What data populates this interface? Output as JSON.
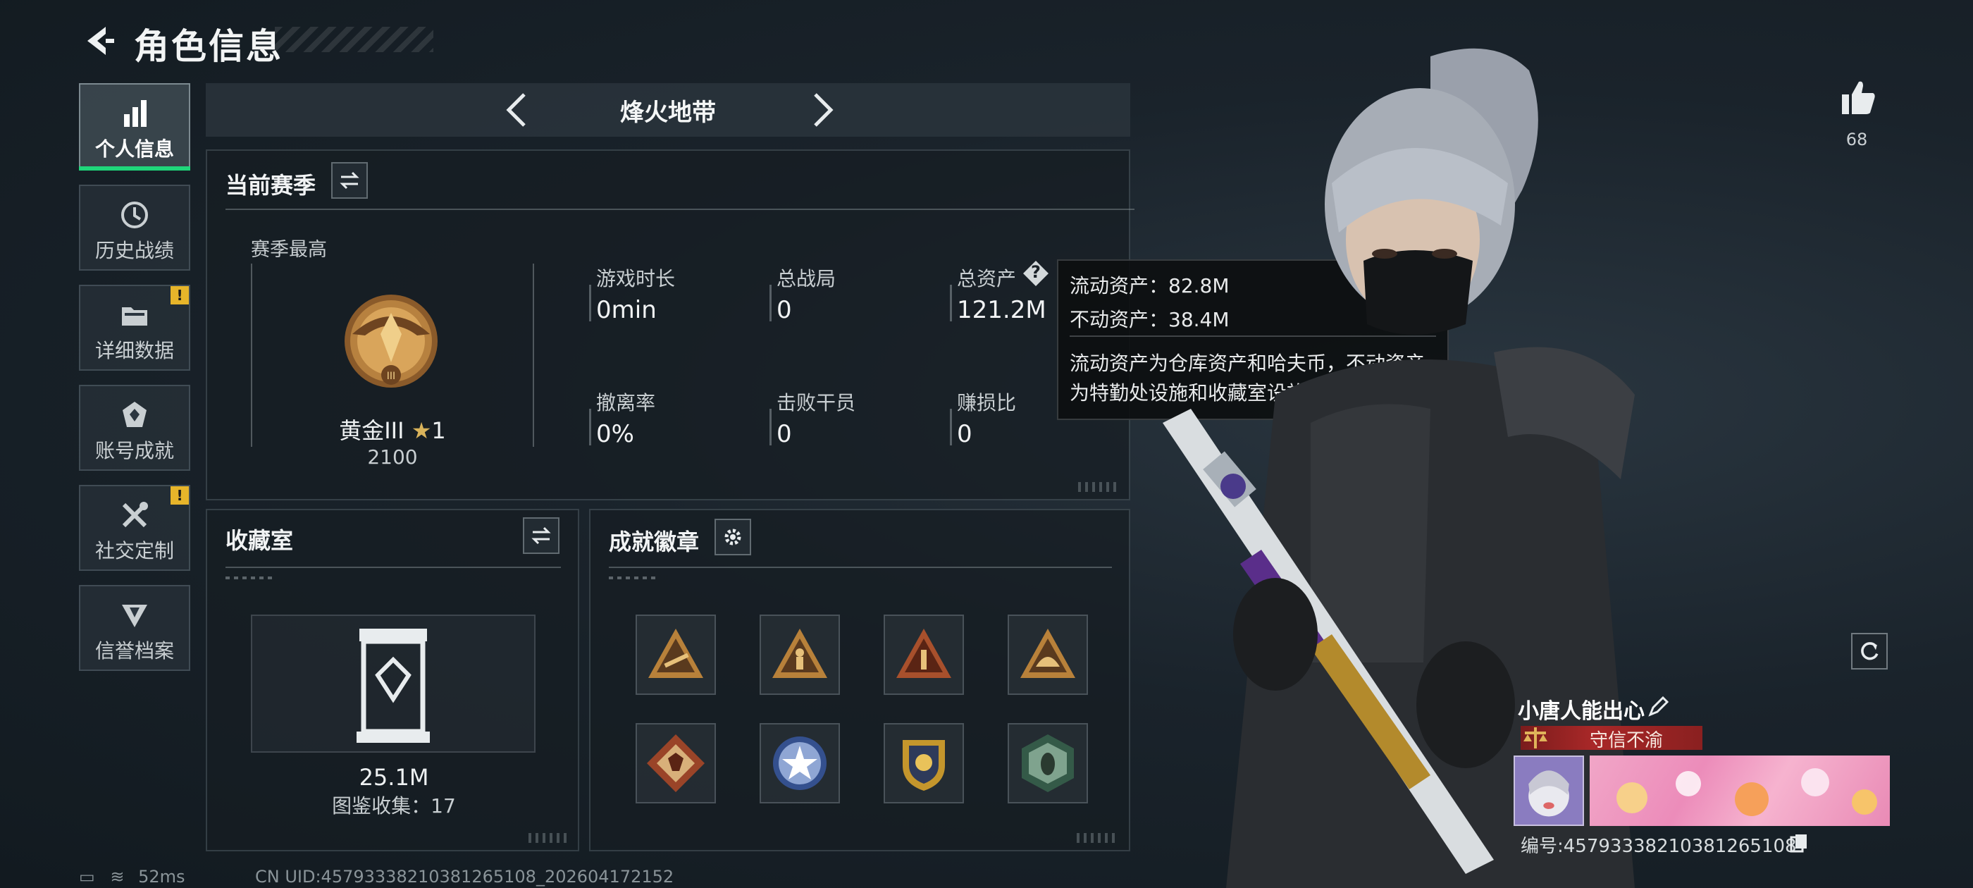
{
  "header": {
    "title": "角色信息"
  },
  "nav": [
    {
      "label": "个人信息",
      "icon": "bar-chart-icon",
      "active": true,
      "alert": false
    },
    {
      "label": "历史战绩",
      "icon": "history-clock-icon",
      "active": false,
      "alert": false
    },
    {
      "label": "详细数据",
      "icon": "folder-icon",
      "active": false,
      "alert": true
    },
    {
      "label": "账号成就",
      "icon": "achievement-icon",
      "active": false,
      "alert": false
    },
    {
      "label": "社交定制",
      "icon": "tools-icon",
      "active": false,
      "alert": true
    },
    {
      "label": "信誉档案",
      "icon": "credit-shield-icon",
      "active": false,
      "alert": false
    }
  ],
  "alert_mark": "!",
  "mode": {
    "name": "烽火地带"
  },
  "season": {
    "title": "当前赛季",
    "best_label": "赛季最高",
    "rank_name": "黄金III",
    "rank_stars": "1",
    "rank_points": "2100",
    "stats": [
      {
        "label": "游戏时长",
        "value": "0min"
      },
      {
        "label": "总战局",
        "value": "0"
      },
      {
        "label": "总资产",
        "value": "121.2M"
      },
      {
        "label": "撤离率",
        "value": "0%"
      },
      {
        "label": "击败干员",
        "value": "0"
      },
      {
        "label": "赚损比",
        "value": "0"
      }
    ],
    "help_mark": "?"
  },
  "tooltip": {
    "liquid": "流动资产：82.8M",
    "fixed": "不动资产：38.4M",
    "desc1": "流动资产为仓库资产和哈夫币，不动资产",
    "desc2": "为特勤处设施和收藏室设施"
  },
  "collection": {
    "title": "收藏室",
    "value": "25.1M",
    "collected": "图鉴收集：17"
  },
  "achievements": {
    "title": "成就徽章",
    "badges": [
      {
        "icon": "badge-triangle-gun-icon",
        "color": "#c98a3a"
      },
      {
        "icon": "badge-triangle-figure-icon",
        "color": "#c98a3a"
      },
      {
        "icon": "badge-triangle-number-one-icon",
        "color": "#b5562c"
      },
      {
        "icon": "badge-triangle-helmet-icon",
        "color": "#c98a3a"
      },
      {
        "icon": "badge-diamond-wolf-icon",
        "color": "#a84a2e"
      },
      {
        "icon": "badge-star-circle-icon",
        "color": "#3d5a9e"
      },
      {
        "icon": "badge-shield-crest-icon",
        "color": "#c79a2c"
      },
      {
        "icon": "badge-hexagon-hornet-icon",
        "color": "#3e6b55"
      }
    ]
  },
  "profile": {
    "likes": "68",
    "name": "小唐人能出心",
    "title_badge": "守信不渝",
    "id_text": "编号:457933382103812651​08"
  },
  "status": {
    "ping": "52ms",
    "uid": "CN UID:457933382103812651​08_202604172152"
  },
  "colors": {
    "accent_green": "#1fd67a",
    "alert_yellow": "#e7b52a",
    "title_red": "#a92828"
  }
}
